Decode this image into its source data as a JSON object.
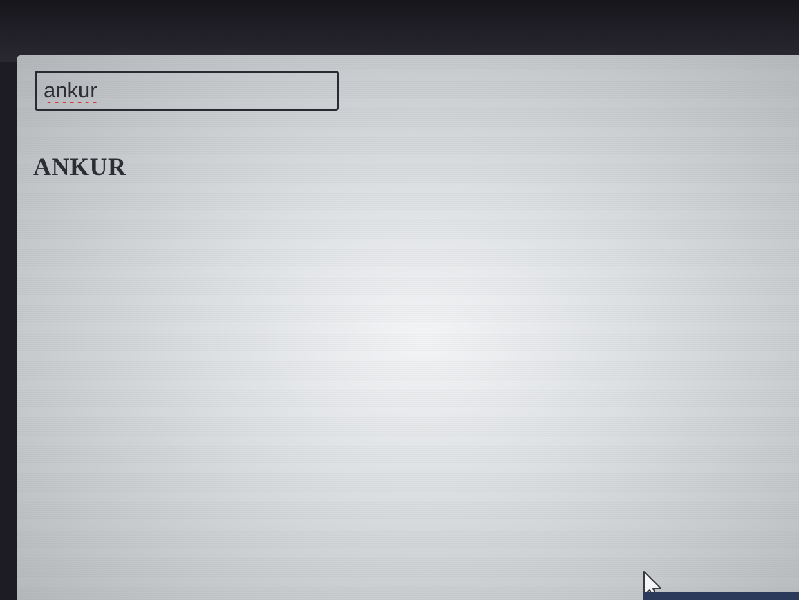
{
  "search": {
    "value": "ankur"
  },
  "output": {
    "text": "ANKUR"
  },
  "icons": {
    "cursor": "mouse-pointer-icon"
  },
  "colors": {
    "spellcheck_underline": "#d23a3a",
    "input_border": "#2a2a33",
    "text": "#2d2d34"
  }
}
